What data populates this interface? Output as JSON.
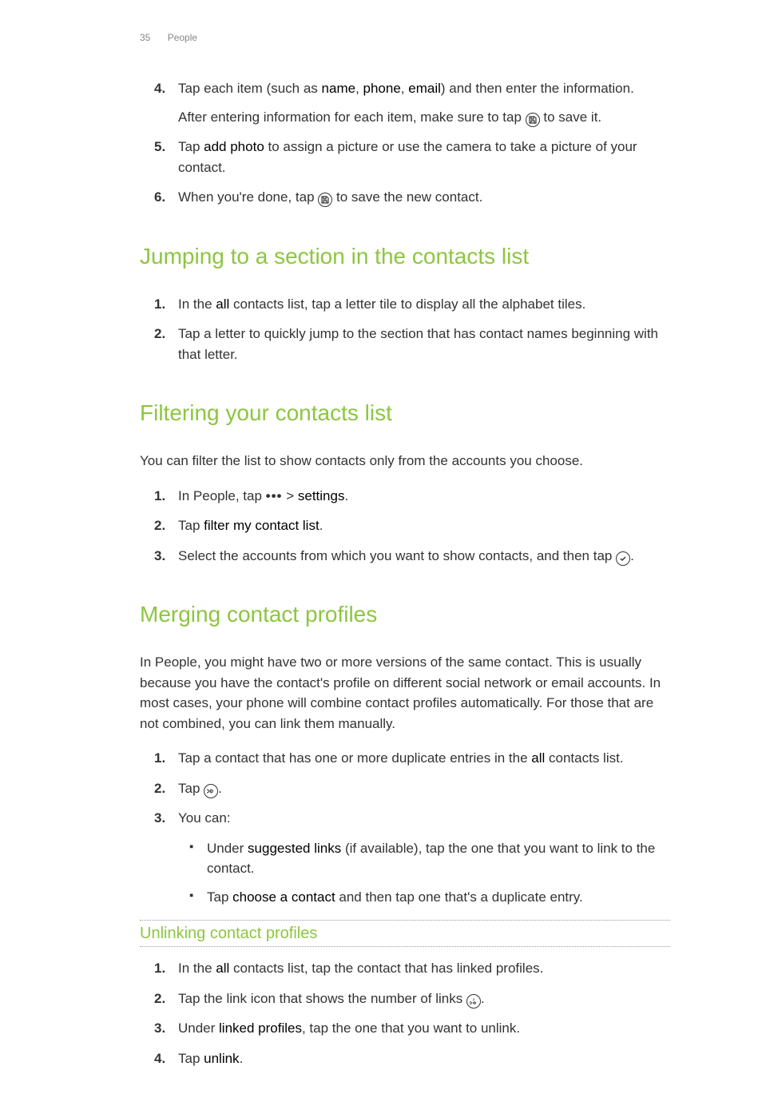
{
  "header": {
    "page_number": "35",
    "section": "People"
  },
  "intro_list": {
    "item4": {
      "num": "4.",
      "pre": "Tap each item (such as ",
      "name": "name",
      "sep1": ", ",
      "phone": "phone",
      "sep2": ", ",
      "email": "email",
      "post": ") and then enter the information.",
      "sub": "After entering information for each item, make sure to tap ",
      "sub_post": " to save it."
    },
    "item5": {
      "num": "5.",
      "pre": "Tap ",
      "add_photo": "add photo",
      "post": " to assign a picture or use the camera to take a picture of your contact."
    },
    "item6": {
      "num": "6.",
      "pre": "When you're done, tap ",
      "post": " to save the new contact."
    }
  },
  "jumping": {
    "heading": "Jumping to a section in the contacts list",
    "item1": {
      "num": "1.",
      "pre": "In the ",
      "all": "all",
      "post": " contacts list, tap a letter tile to display all the alphabet tiles."
    },
    "item2": {
      "num": "2.",
      "text": "Tap a letter to quickly jump to the section that has contact names beginning with that letter."
    }
  },
  "filtering": {
    "heading": "Filtering your contacts list",
    "intro": "You can filter the list to show contacts only from the accounts you choose.",
    "item1": {
      "num": "1.",
      "pre": "In People, tap ",
      "dots": "•••",
      "mid": " > ",
      "settings": "settings",
      "post": "."
    },
    "item2": {
      "num": "2.",
      "pre": "Tap ",
      "filter": "filter my contact list",
      "post": "."
    },
    "item3": {
      "num": "3.",
      "pre": "Select the accounts from which you want to show contacts, and then tap ",
      "post": "."
    }
  },
  "merging": {
    "heading": "Merging contact profiles",
    "intro": "In People, you might have two or more versions of the same contact. This is usually because you have the contact's profile on different social network or email accounts. In most cases, your phone will combine contact profiles automatically. For those that are not combined, you can link them manually.",
    "item1": {
      "num": "1.",
      "pre": "Tap a contact that has one or more duplicate entries in the ",
      "all": "all",
      "post": " contacts list."
    },
    "item2": {
      "num": "2.",
      "pre": "Tap ",
      "post": "."
    },
    "item3": {
      "num": "3.",
      "text": "You can:",
      "bullet1": {
        "pre": "Under ",
        "suggested": "suggested links",
        "post": " (if available), tap the one that you want to link to the contact."
      },
      "bullet2": {
        "pre": "Tap ",
        "choose": "choose a contact",
        "post": " and then tap one that's a duplicate entry."
      }
    }
  },
  "unlinking": {
    "heading": "Unlinking contact profiles",
    "item1": {
      "num": "1.",
      "pre": "In the ",
      "all": "all",
      "post": " contacts list, tap the contact that has linked profiles."
    },
    "item2": {
      "num": "2.",
      "pre": "Tap the link icon that shows the number of links ",
      "post": "."
    },
    "item3": {
      "num": "3.",
      "pre": "Under ",
      "linked": "linked profiles",
      "post": ", tap the one that you want to unlink."
    },
    "item4": {
      "num": "4.",
      "pre": "Tap ",
      "unlink": "unlink",
      "post": "."
    }
  }
}
